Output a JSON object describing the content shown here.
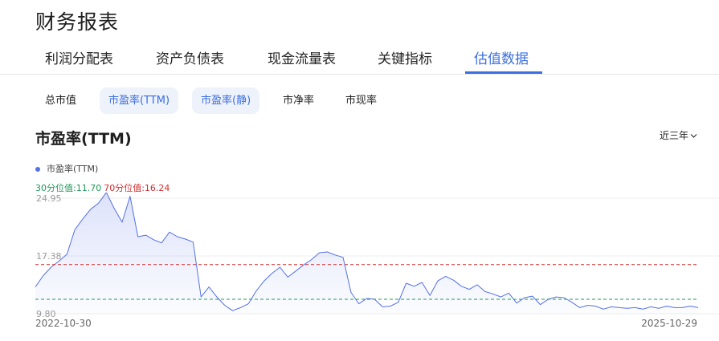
{
  "page_title": "财务报表",
  "tabs": [
    {
      "label": "利润分配表",
      "active": false
    },
    {
      "label": "资产负债表",
      "active": false
    },
    {
      "label": "现金流量表",
      "active": false
    },
    {
      "label": "关键指标",
      "active": false
    },
    {
      "label": "估值数据",
      "active": true
    }
  ],
  "subtabs": [
    {
      "label": "总市值",
      "active": false
    },
    {
      "label": "市盈率(TTM)",
      "active": true
    },
    {
      "label": "市盈率(静)",
      "active": true
    },
    {
      "label": "市净率",
      "active": false
    },
    {
      "label": "市现率",
      "active": false
    }
  ],
  "chart_title": "市盈率(TTM)",
  "range_selector": {
    "label": "近三年",
    "icon": "chevron-down-icon"
  },
  "colors": {
    "accent": "#3b6fe0",
    "line": "#5470e6",
    "p30": "#1e9a5a",
    "p70": "#d12c2c"
  },
  "chart_data": {
    "type": "area",
    "legend": [
      "市盈率(TTM)"
    ],
    "ylim": [
      9.8,
      24.95
    ],
    "y_ticks": [
      "24.95",
      "17.38",
      "9.80"
    ],
    "x_start_label": "2022-10-30",
    "x_end_label": "2025-10-29",
    "percentile_30": {
      "label": "30分位值:",
      "value": "11.70"
    },
    "percentile_70": {
      "label": "70分位值:",
      "value": "16.24"
    },
    "series": [
      {
        "name": "市盈率(TTM)",
        "x": [
          "2022-10-30",
          "2022-11-12",
          "2022-11-25",
          "2022-12-08",
          "2022-12-21",
          "2023-01-03",
          "2023-01-16",
          "2023-01-29",
          "2023-02-11",
          "2023-02-24",
          "2023-03-09",
          "2023-03-22",
          "2023-04-04",
          "2023-04-17",
          "2023-04-30",
          "2023-05-13",
          "2023-05-26",
          "2023-06-08",
          "2023-06-21",
          "2023-07-04",
          "2023-07-17",
          "2023-07-30",
          "2023-08-12",
          "2023-08-25",
          "2023-09-07",
          "2023-09-20",
          "2023-10-03",
          "2023-10-16",
          "2023-10-29",
          "2023-11-11",
          "2023-11-24",
          "2023-12-07",
          "2023-12-20",
          "2024-01-02",
          "2024-01-15",
          "2024-01-28",
          "2024-02-10",
          "2024-02-23",
          "2024-03-07",
          "2024-03-20",
          "2024-04-02",
          "2024-04-15",
          "2024-04-28",
          "2024-05-11",
          "2024-05-24",
          "2024-06-06",
          "2024-06-19",
          "2024-07-02",
          "2024-07-15",
          "2024-07-28",
          "2024-08-10",
          "2024-08-23",
          "2024-09-05",
          "2024-09-18",
          "2024-10-01",
          "2024-10-14",
          "2024-10-27",
          "2024-11-09",
          "2024-11-22",
          "2024-12-05",
          "2024-12-18",
          "2024-12-31",
          "2025-01-13",
          "2025-01-26",
          "2025-02-08",
          "2025-02-21",
          "2025-03-06",
          "2025-03-19",
          "2025-04-01",
          "2025-04-14",
          "2025-04-27",
          "2025-05-10",
          "2025-05-23",
          "2025-06-05",
          "2025-06-18",
          "2025-07-01",
          "2025-07-14",
          "2025-07-27",
          "2025-08-09",
          "2025-08-22",
          "2025-09-04",
          "2025-09-17",
          "2025-09-30",
          "2025-10-13",
          "2025-10-29"
        ],
        "values": [
          13.3,
          14.8,
          15.9,
          16.7,
          17.6,
          20.8,
          22.2,
          23.5,
          24.3,
          25.7,
          23.6,
          21.8,
          25.2,
          19.9,
          20.1,
          19.5,
          19.1,
          20.5,
          19.9,
          19.6,
          19.2,
          12.0,
          13.3,
          12.0,
          10.9,
          10.2,
          10.6,
          11.1,
          12.8,
          14.1,
          15.1,
          15.9,
          14.6,
          15.4,
          16.2,
          16.9,
          17.8,
          17.9,
          17.5,
          17.2,
          12.6,
          11.1,
          11.8,
          11.7,
          10.7,
          10.8,
          11.3,
          13.8,
          13.4,
          13.9,
          12.2,
          14.1,
          14.7,
          14.2,
          13.4,
          13.0,
          13.6,
          12.7,
          12.4,
          12.0,
          12.5,
          11.2,
          11.9,
          12.1,
          11.0,
          11.7,
          12.0,
          11.9,
          11.3,
          10.6,
          10.9,
          10.8,
          10.4,
          10.7,
          10.6,
          10.5,
          10.6,
          10.4,
          10.7,
          10.5,
          10.8,
          10.6,
          10.6,
          10.8,
          10.6
        ]
      }
    ]
  }
}
